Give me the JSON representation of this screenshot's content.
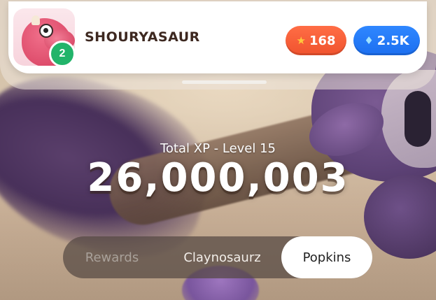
{
  "player": {
    "username": "SHOURYASAUR",
    "avatar_level": "2",
    "avatar_icon": "pink-dino-avatar"
  },
  "currency": {
    "stars": "168",
    "stars_icon": "star-icon",
    "gems": "2.5K",
    "gems_icon": "diamond-icon"
  },
  "xp": {
    "label": "Total XP - Level 15",
    "value": "26,000,003"
  },
  "tabs": [
    {
      "label": "Rewards",
      "state": "disabled"
    },
    {
      "label": "Claynosaurz",
      "state": "normal"
    },
    {
      "label": "Popkins",
      "state": "selected"
    }
  ],
  "colors": {
    "stars_pill": "#f0532e",
    "gems_pill": "#1c6ff0",
    "level_badge": "#22b46a",
    "selected_tab": "#ffffff"
  }
}
